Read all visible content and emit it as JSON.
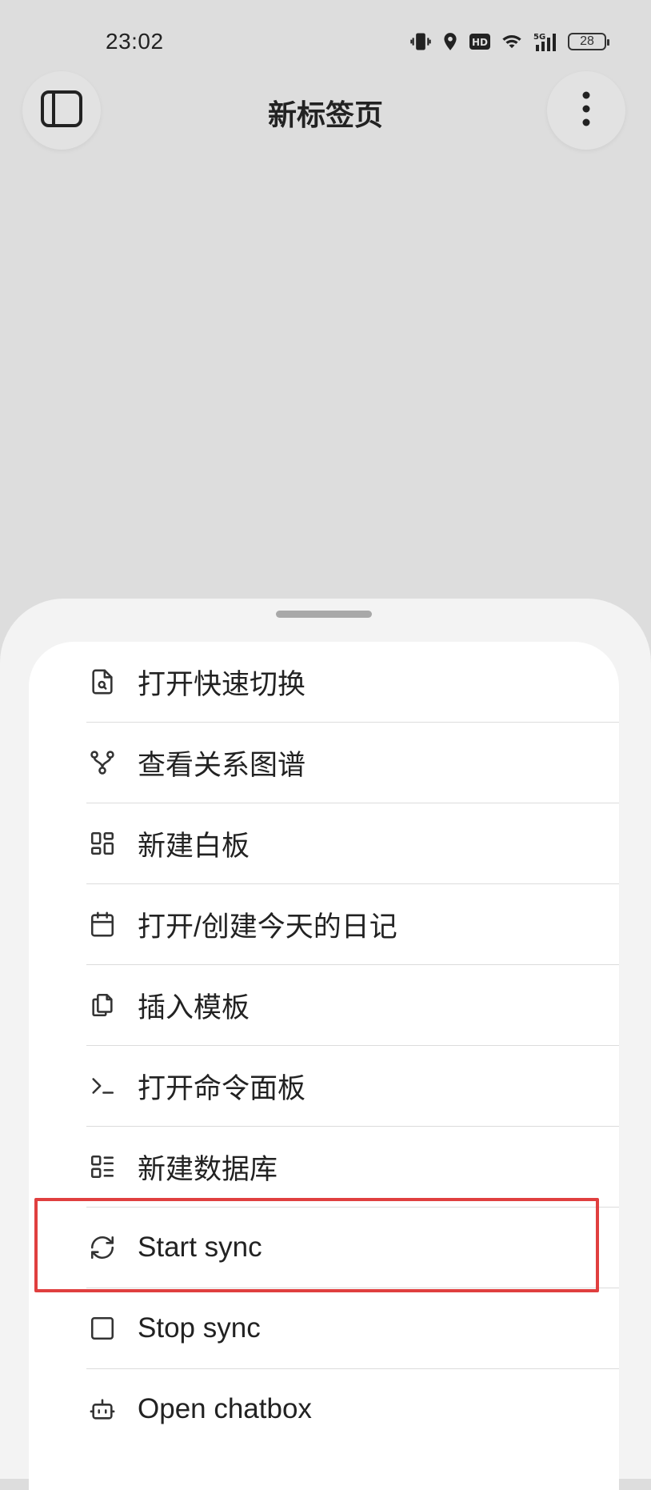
{
  "status_bar": {
    "time": "23:02",
    "battery": "28",
    "network": "5G"
  },
  "header": {
    "title": "新标签页"
  },
  "menu": {
    "items": [
      {
        "label": "打开快速切换",
        "icon": "file-search-icon"
      },
      {
        "label": "查看关系图谱",
        "icon": "graph-icon"
      },
      {
        "label": "新建白板",
        "icon": "layout-dashboard-icon"
      },
      {
        "label": "打开/创建今天的日记",
        "icon": "calendar-icon"
      },
      {
        "label": "插入模板",
        "icon": "copy-icon"
      },
      {
        "label": "打开命令面板",
        "icon": "terminal-icon"
      },
      {
        "label": "新建数据库",
        "icon": "database-list-icon"
      },
      {
        "label": "Start sync",
        "icon": "refresh-icon"
      },
      {
        "label": "Stop sync",
        "icon": "square-icon"
      },
      {
        "label": "Open chatbox",
        "icon": "bot-icon"
      }
    ]
  },
  "colors": {
    "highlight": "#e03f3f",
    "background": "#dddddd",
    "sheet": "#f3f3f3",
    "card": "#ffffff"
  }
}
